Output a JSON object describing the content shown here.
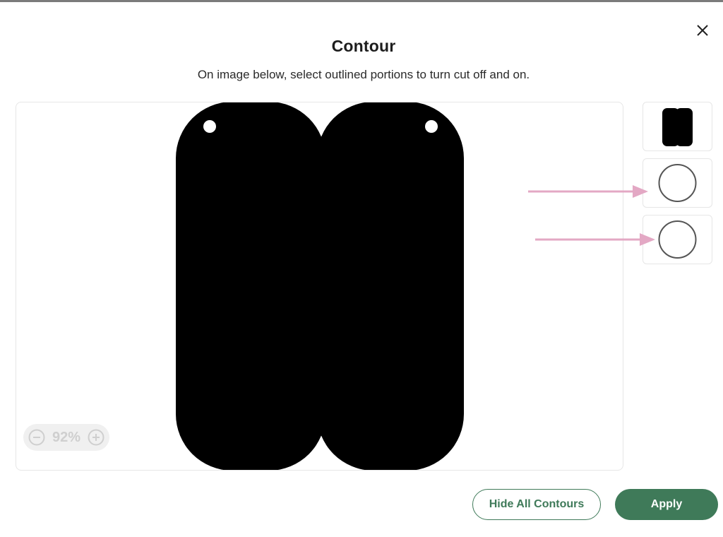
{
  "dialog": {
    "title": "Contour",
    "subtitle": "On image below, select outlined portions to turn cut off and on.",
    "close_icon": "close-icon"
  },
  "canvas": {
    "zoom_level": "92%",
    "zoom_out_icon": "minus-circle-icon",
    "zoom_in_icon": "plus-circle-icon"
  },
  "contour_layers": [
    {
      "name": "tag-shape-layer",
      "icon": "double-tag-thumbnail"
    },
    {
      "name": "hole-layer-1",
      "icon": "circle-outline-thumbnail",
      "highlighted": true
    },
    {
      "name": "hole-layer-2",
      "icon": "circle-outline-thumbnail",
      "highlighted": true
    }
  ],
  "colors": {
    "accent": "#3f7a59",
    "arrow": "#e3a8c4",
    "shape_fill": "#000000"
  },
  "actions": {
    "hide_all_label": "Hide All Contours",
    "apply_label": "Apply"
  }
}
